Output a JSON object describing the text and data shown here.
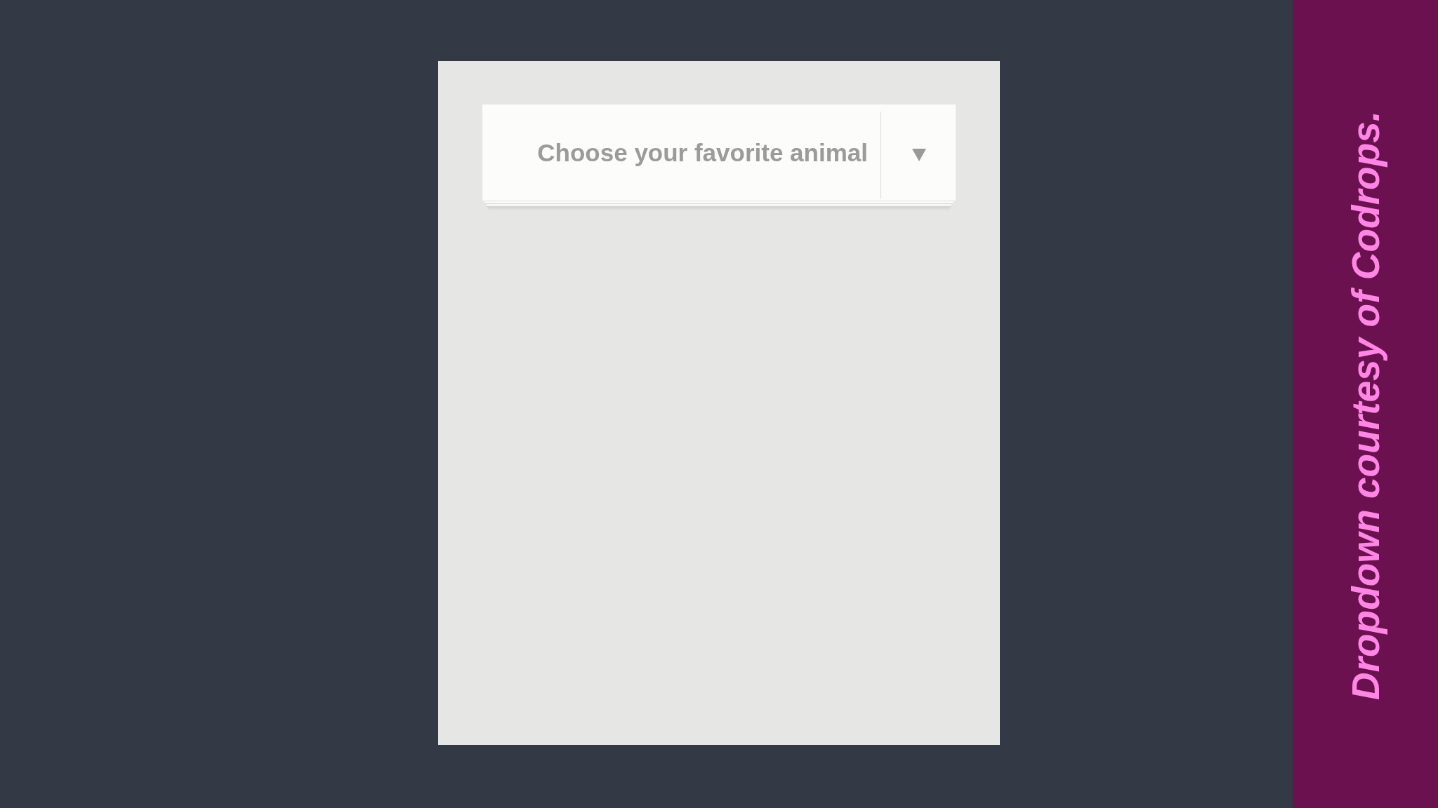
{
  "dropdown": {
    "label": "Choose your favorite animal"
  },
  "credit": {
    "text": "Dropdown courtesy of Codrops."
  }
}
